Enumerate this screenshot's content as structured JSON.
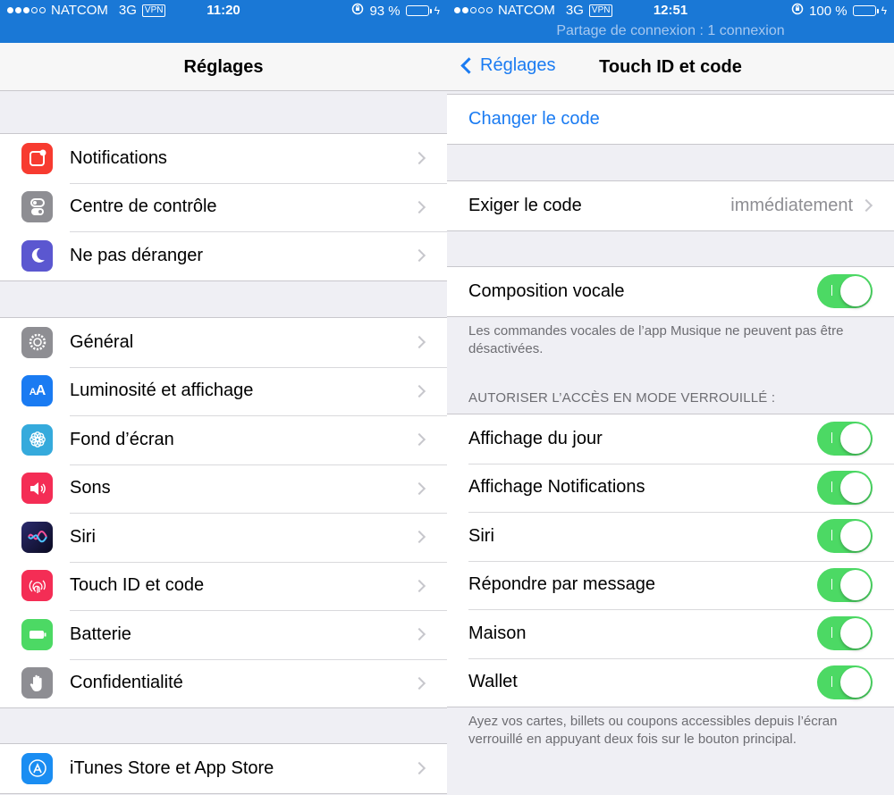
{
  "left_screen": {
    "status_bar": {
      "carrier": "NATCOM",
      "network": "3G",
      "vpn": "VPN",
      "time": "11:20",
      "battery_text": "93 %",
      "battery_level": 0.93
    },
    "nav_title": "Réglages",
    "groups": [
      {
        "items": [
          {
            "label": "Notifications",
            "icon": "notifications-icon",
            "color": "#f73b30"
          },
          {
            "label": "Centre de contrôle",
            "icon": "control-center-icon",
            "color": "#8e8e93"
          },
          {
            "label": "Ne pas déranger",
            "icon": "moon-icon",
            "color": "#5b57d0"
          }
        ]
      },
      {
        "items": [
          {
            "label": "Général",
            "icon": "gear-icon",
            "color": "#8e8e93"
          },
          {
            "label": "Luminosité et affichage",
            "icon": "text-size-icon",
            "color": "#1a7bf2",
            "glyph": "AA"
          },
          {
            "label": "Fond d’écran",
            "icon": "flower-icon",
            "color": "#35aadc"
          },
          {
            "label": "Sons",
            "icon": "speaker-icon",
            "color": "#f42d55"
          },
          {
            "label": "Siri",
            "icon": "siri-icon",
            "color": "#1b1b3a"
          },
          {
            "label": "Touch ID et code",
            "icon": "fingerprint-icon",
            "color": "#f42d55"
          },
          {
            "label": "Batterie",
            "icon": "battery-icon",
            "color": "#4cd964"
          },
          {
            "label": "Confidentialité",
            "icon": "hand-icon",
            "color": "#8e8e93"
          }
        ]
      },
      {
        "items": [
          {
            "label": "iTunes Store et App Store",
            "icon": "app-store-icon",
            "color": "#1a8df2"
          }
        ]
      }
    ]
  },
  "right_screen": {
    "status_bar": {
      "carrier": "NATCOM",
      "network": "3G",
      "vpn": "VPN",
      "time": "12:51",
      "battery_text": "100 %",
      "battery_level": 1.0
    },
    "hotspot_text": "Partage de connexion : 1 connexion",
    "back_label": "Réglages",
    "nav_title": "Touch ID et code",
    "change_code": "Changer le code",
    "require_code": {
      "label": "Exiger le code",
      "value": "immédiatement"
    },
    "voice_dial": {
      "label": "Composition vocale",
      "on": true
    },
    "voice_footnote": "Les commandes vocales de l’app Musique ne peuvent pas être désactivées.",
    "locked_header": "AUTORISER L’ACCÈS EN MODE VERROUILLÉ :",
    "locked_items": [
      {
        "label": "Affichage du jour",
        "on": true
      },
      {
        "label": "Affichage Notifications",
        "on": true
      },
      {
        "label": "Siri",
        "on": true
      },
      {
        "label": "Répondre par message",
        "on": true
      },
      {
        "label": "Maison",
        "on": true
      },
      {
        "label": "Wallet",
        "on": true
      }
    ],
    "wallet_footnote": "Ayez vos cartes, billets ou coupons accessibles depuis l’écran verrouillé en appuyant deux fois sur le bouton principal."
  }
}
